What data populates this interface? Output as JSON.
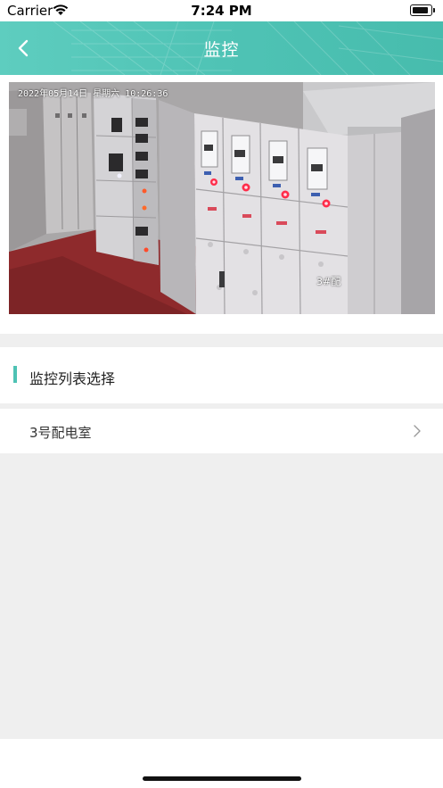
{
  "status_bar": {
    "carrier": "Carrier",
    "time": "7:24 PM"
  },
  "nav": {
    "title": "监控",
    "back_icon": "chevron-left-icon"
  },
  "camera_feed": {
    "timestamp": "2022年05月14日 星期六 10:26:36",
    "overlay_label": "3#配"
  },
  "section": {
    "title": "监控列表选择",
    "accent_color": "#4ec2b4"
  },
  "list": {
    "items": [
      {
        "label": "3号配电室",
        "icon": "chevron-right-icon"
      }
    ]
  },
  "colors": {
    "nav_bg": "#4fc3b5",
    "page_bg": "#efefef"
  }
}
